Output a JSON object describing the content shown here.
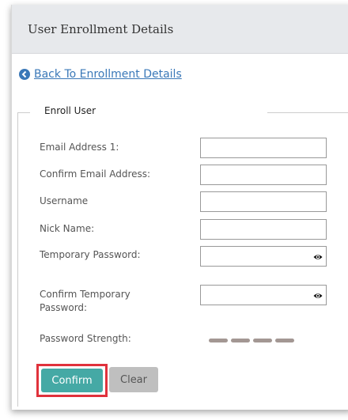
{
  "panel": {
    "title": "User Enrollment Details"
  },
  "back_link": {
    "label": "Back To Enrollment Details"
  },
  "form": {
    "legend": "Enroll User",
    "email_label": "Email Address 1:",
    "confirm_email_label": "Confirm Email Address:",
    "username_label": "Username",
    "nickname_label": "Nick Name:",
    "temp_password_label": "Temporary Password:",
    "confirm_temp_password_label_line1": "Confirm Temporary",
    "confirm_temp_password_label_line2": "Password:",
    "strength_label": "Password Strength:",
    "email_value": "",
    "confirm_email_value": "",
    "username_value": "",
    "nickname_value": "",
    "temp_password_value": "",
    "confirm_temp_password_value": ""
  },
  "buttons": {
    "confirm": "Confirm",
    "clear": "Clear"
  },
  "icons": {
    "back": "arrow-left-circle-icon",
    "eye": "eye-icon"
  },
  "colors": {
    "link": "#3a78b8",
    "confirm_button": "#45a9a5",
    "highlight_border": "#e0323c",
    "header_bg": "#e7e9ec"
  }
}
